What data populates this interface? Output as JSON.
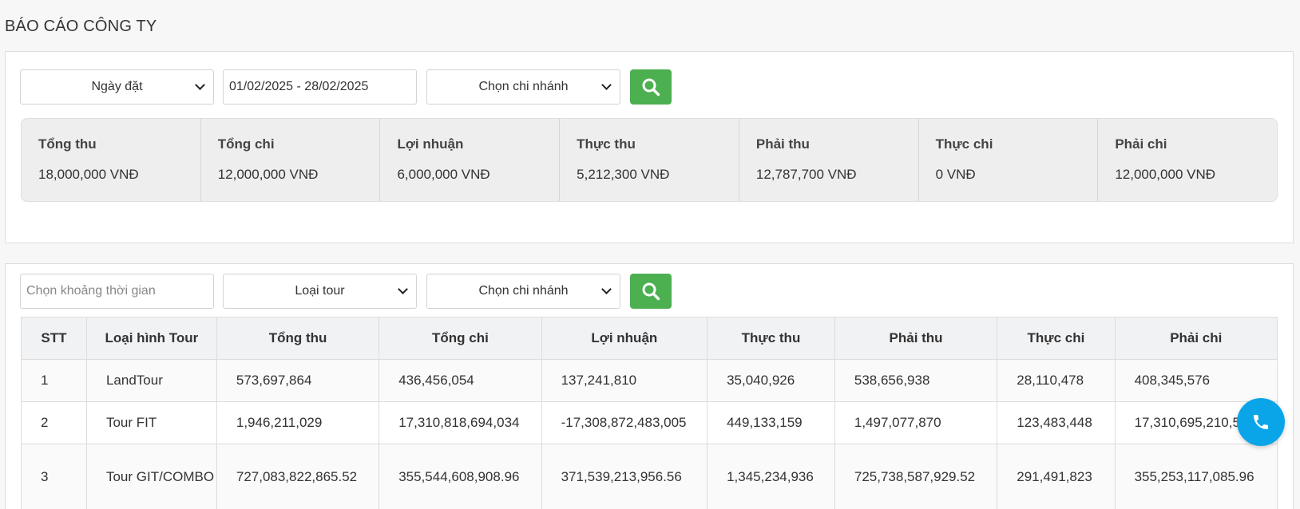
{
  "page_title": "BÁO CÁO CÔNG TY",
  "colors": {
    "search_button": "#4caf50",
    "call_button": "#0aa5e8",
    "summary_bg": "#eeeeee",
    "header_bg": "#f1f2f4"
  },
  "summary_filters": {
    "date_type": {
      "value": "Ngày đặt"
    },
    "date_range": {
      "value": "01/02/2025 - 28/02/2025"
    },
    "branch": {
      "value": "Chọn chi nhánh"
    },
    "search_icon": "search-icon"
  },
  "summary": [
    {
      "label": "Tổng thu",
      "value": "18,000,000 VNĐ"
    },
    {
      "label": "Tổng chi",
      "value": "12,000,000 VNĐ"
    },
    {
      "label": "Lợi nhuận",
      "value": "6,000,000 VNĐ"
    },
    {
      "label": "Thực thu",
      "value": "5,212,300 VNĐ"
    },
    {
      "label": "Phải thu",
      "value": "12,787,700 VNĐ"
    },
    {
      "label": "Thực chi",
      "value": "0 VNĐ"
    },
    {
      "label": "Phải chi",
      "value": "12,000,000 VNĐ"
    }
  ],
  "table_filters": {
    "time_range": {
      "placeholder": "Chọn khoảng thời gian"
    },
    "tour_type": {
      "value": "Loại tour"
    },
    "branch": {
      "value": "Chọn chi nhánh"
    },
    "search_icon": "search-icon"
  },
  "table": {
    "headers": [
      "STT",
      "Loại hình Tour",
      "Tổng thu",
      "Tổng chi",
      "Lợi nhuận",
      "Thực thu",
      "Phải thu",
      "Thực chi",
      "Phải chi"
    ],
    "rows": [
      [
        "1",
        "LandTour",
        "573,697,864",
        "436,456,054",
        "137,241,810",
        "35,040,926",
        "538,656,938",
        "28,110,478",
        "408,345,576"
      ],
      [
        "2",
        "Tour FIT",
        "1,946,211,029",
        "17,310,818,694,034",
        "-17,308,872,483,005",
        "449,133,159",
        "1,497,077,870",
        "123,483,448",
        "17,310,695,210,586"
      ],
      [
        "3",
        "Tour GIT/COMBO",
        "727,083,822,865.52",
        "355,544,608,908.96",
        "371,539,213,956.56",
        "1,345,234,936",
        "725,738,587,929.52",
        "291,491,823",
        "355,253,117,085.96"
      ]
    ]
  },
  "call_button_icon": "phone-icon"
}
